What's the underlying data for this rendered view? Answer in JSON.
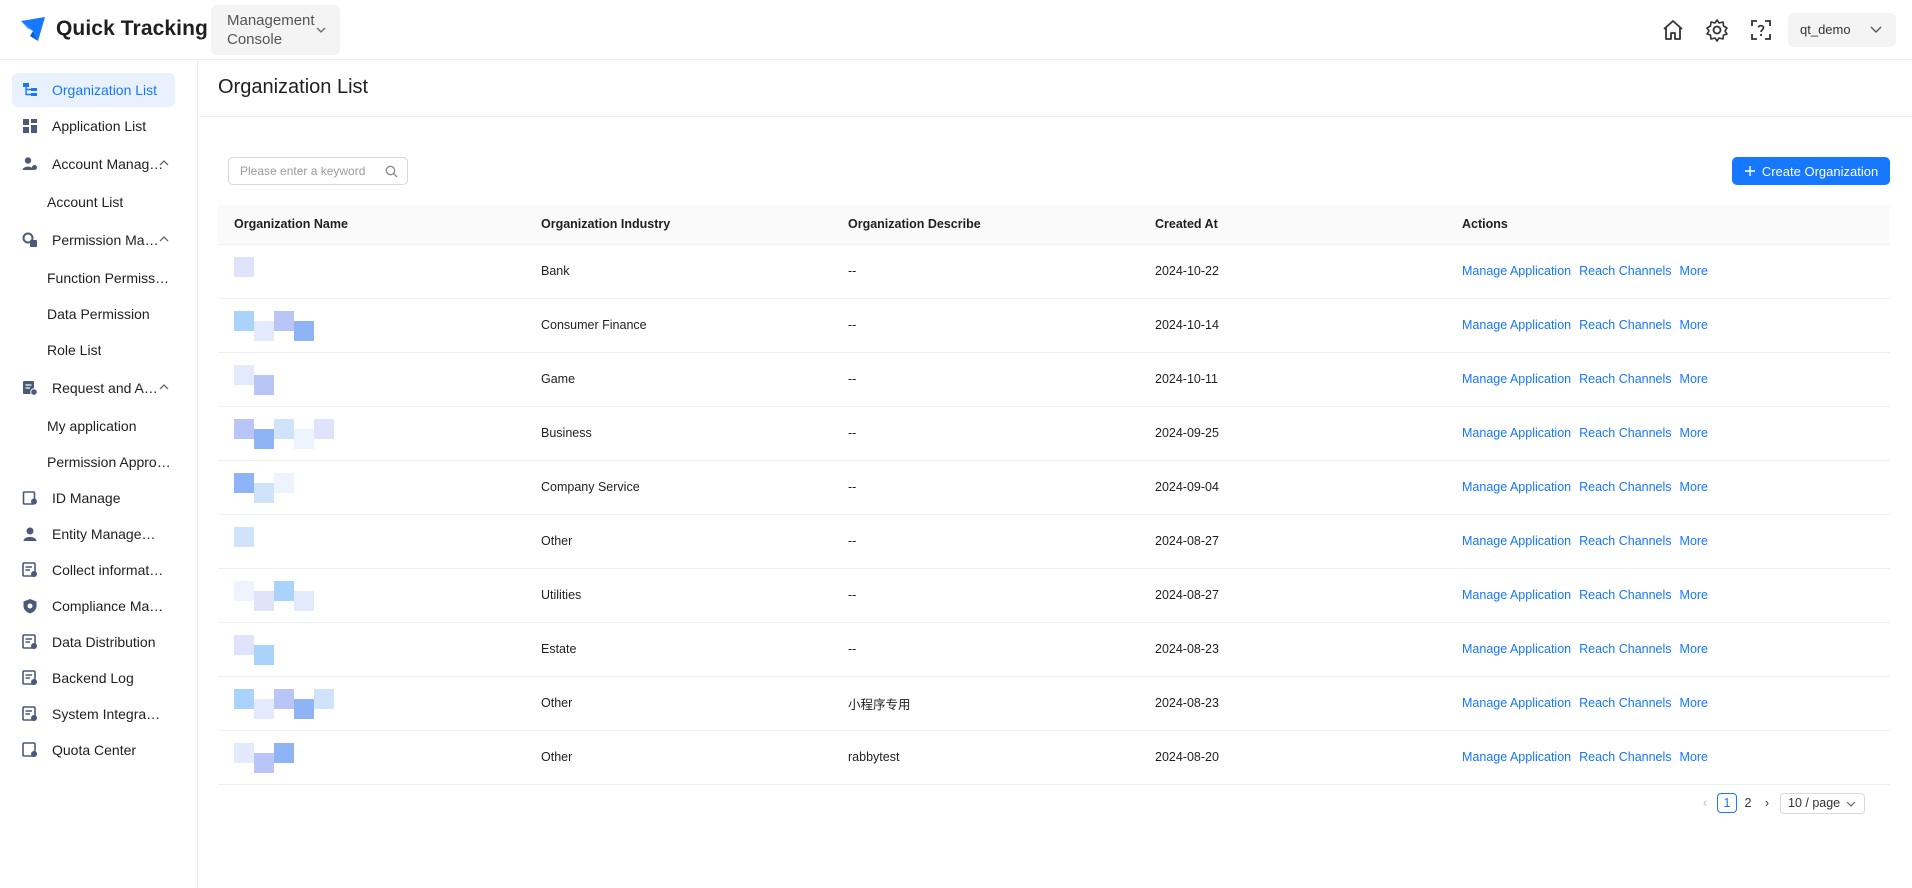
{
  "app": {
    "name": "Quick Tracking",
    "console_label": "Management Console",
    "user": "qt_demo",
    "brand_color": "#1677ff"
  },
  "header_icons": [
    "home-icon",
    "gear-icon",
    "help-scan-icon"
  ],
  "sidebar": {
    "items": [
      {
        "label": "Organization List",
        "icon": "org-list-icon",
        "active": true
      },
      {
        "label": "Application List",
        "icon": "app-grid-icon"
      },
      {
        "label": "Account Management",
        "icon": "account-icon",
        "expanded": true,
        "children": [
          "Account List"
        ]
      },
      {
        "label": "Permission Management",
        "icon": "permission-icon",
        "expanded": true,
        "children": [
          "Function Permission",
          "Data Permission",
          "Role List"
        ]
      },
      {
        "label": "Request and Approval",
        "icon": "request-icon",
        "expanded": true,
        "children": [
          "My application",
          "Permission Approval"
        ]
      },
      {
        "label": "ID Manage",
        "icon": "id-icon"
      },
      {
        "label": "Entity Management",
        "icon": "entity-icon"
      },
      {
        "label": "Collect information",
        "icon": "collect-icon"
      },
      {
        "label": "Compliance Management",
        "icon": "shield-icon"
      },
      {
        "label": "Data Distribution",
        "icon": "distribution-icon"
      },
      {
        "label": "Backend Log",
        "icon": "log-icon"
      },
      {
        "label": "System Integration",
        "icon": "integration-icon"
      },
      {
        "label": "Quota Center",
        "icon": "quota-icon"
      }
    ]
  },
  "main": {
    "title": "Organization List",
    "search_placeholder": "Please enter a keyword",
    "create_label": "Create Organization",
    "columns": [
      "Organization Name",
      "Organization Industry",
      "Organization Describe",
      "Created At",
      "Actions"
    ],
    "action_labels": [
      "Manage Application",
      "Reach Channels",
      "More"
    ],
    "rows": [
      {
        "industry": "Bank",
        "describe": "--",
        "created": "2024-10-22"
      },
      {
        "industry": "Consumer Finance",
        "describe": "--",
        "created": "2024-10-14"
      },
      {
        "industry": "Game",
        "describe": "--",
        "created": "2024-10-11"
      },
      {
        "industry": "Business",
        "describe": "--",
        "created": "2024-09-25"
      },
      {
        "industry": "Company Service",
        "describe": "--",
        "created": "2024-09-04"
      },
      {
        "industry": "Other",
        "describe": "--",
        "created": "2024-08-27"
      },
      {
        "industry": "Utilities",
        "describe": "--",
        "created": "2024-08-27"
      },
      {
        "industry": "Estate",
        "describe": "--",
        "created": "2024-08-23"
      },
      {
        "industry": "Other",
        "describe": "小程序专用",
        "created": "2024-08-23"
      },
      {
        "industry": "Other",
        "describe": "rabbytest",
        "created": "2024-08-20"
      }
    ]
  },
  "pagination": {
    "pages": [
      "1",
      "2"
    ],
    "current": "1",
    "page_size": "10 / page"
  }
}
